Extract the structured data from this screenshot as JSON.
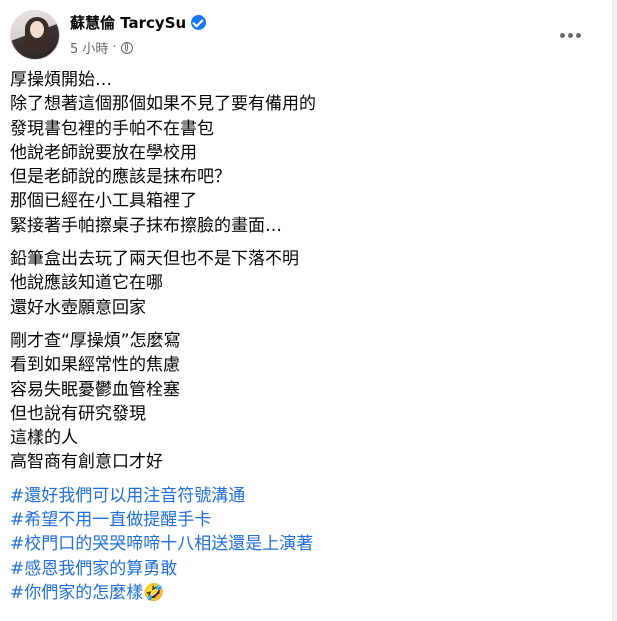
{
  "post": {
    "author": "蘇慧倫 TarcySu",
    "time": "5 小時",
    "meta_separator": "·",
    "more_icon": "more-horizontal-icon",
    "accent_color": "#1877f2",
    "hashtag_color": "#216fdb",
    "paragraphs": [
      [
        "厚操煩開始…",
        "除了想著這個那個如果不見了要有備用的",
        "發現書包裡的手帕不在書包",
        "他說老師說要放在學校用",
        "但是老師說的應該是抹布吧？",
        "那個已經在小工具箱裡了",
        "緊接著手帕擦桌子抹布擦臉的畫面…"
      ],
      [
        "鉛筆盒出去玩了兩天但也不是下落不明",
        "他說應該知道它在哪",
        "還好水壺願意回家"
      ],
      [
        "剛才查“厚操煩”怎麼寫",
        "看到如果經常性的焦慮",
        "容易失眠憂鬱血管栓塞",
        "但也說有研究發現",
        "這樣的人",
        "高智商有創意口才好"
      ]
    ],
    "hashtags": [
      "#還好我們可以用注音符號溝通",
      "#希望不用一直做提醒手卡",
      "#校門口的哭哭啼啼十八相送還是上演著",
      "#感恩我們家的算勇敢",
      "#你們家的怎麼樣🤣"
    ]
  }
}
